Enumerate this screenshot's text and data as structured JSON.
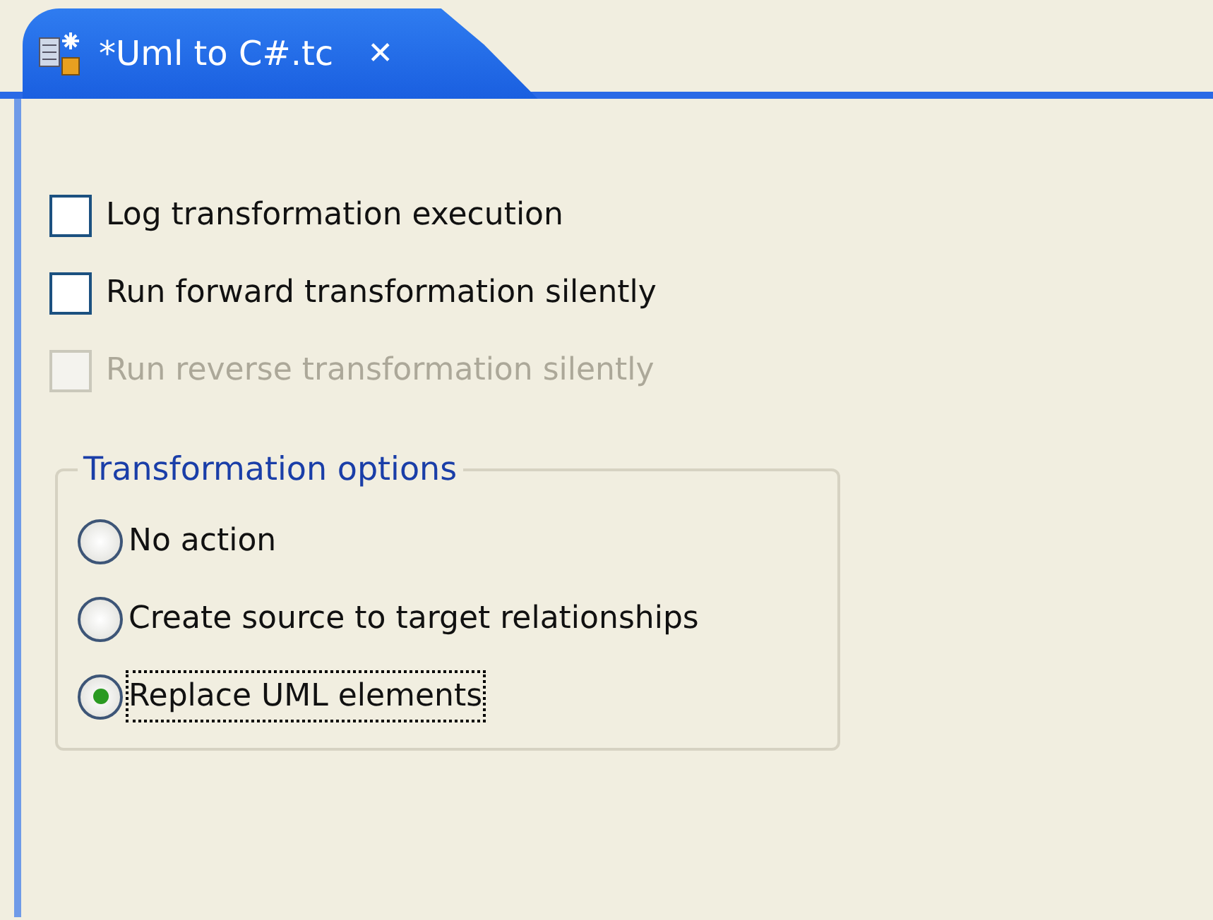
{
  "tab": {
    "title": "*Uml to C#.tc",
    "close": "✕",
    "selected": true
  },
  "checkboxes": [
    {
      "label": "Log transformation execution",
      "checked": false,
      "disabled": false
    },
    {
      "label": "Run forward transformation silently",
      "checked": false,
      "disabled": false
    },
    {
      "label": "Run reverse transformation silently",
      "checked": false,
      "disabled": true
    }
  ],
  "group": {
    "title": "Transformation options",
    "options": [
      {
        "label": "No action",
        "selected": false,
        "focused": false
      },
      {
        "label": "Create source to target relationships",
        "selected": false,
        "focused": false
      },
      {
        "label": "Replace UML elements",
        "selected": true,
        "focused": true
      }
    ]
  }
}
